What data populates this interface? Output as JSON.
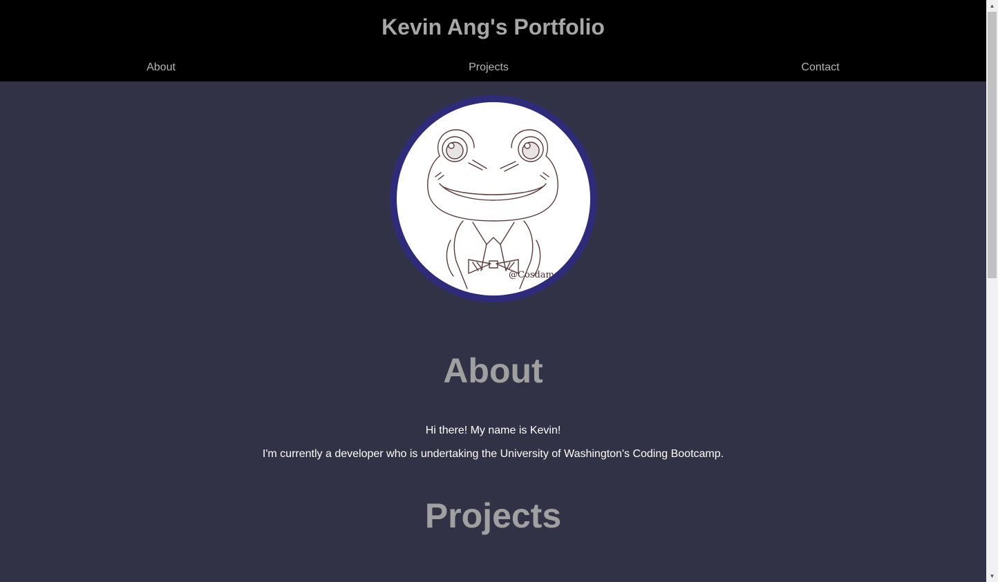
{
  "header": {
    "title": "Kevin Ang's Portfolio",
    "nav": {
      "about": "About",
      "projects": "Projects",
      "contact": "Contact"
    }
  },
  "avatar": {
    "signature": "@Cosdaman",
    "subject": "frog-in-suit-sketch"
  },
  "about": {
    "heading": "About",
    "line1": "Hi there! My name is Kevin!",
    "line2": "I'm currently a developer who is undertaking the University of Washington's Coding Bootcamp."
  },
  "projects": {
    "heading": "Projects"
  },
  "scrollbar": {
    "up_icon": "▲",
    "down_icon": "▼"
  },
  "colors": {
    "header_bg": "#000000",
    "page_bg": "#323246",
    "avatar_ring": "#2e2c7a",
    "heading_text": "#a0a0a0",
    "body_text": "#ffffff"
  }
}
